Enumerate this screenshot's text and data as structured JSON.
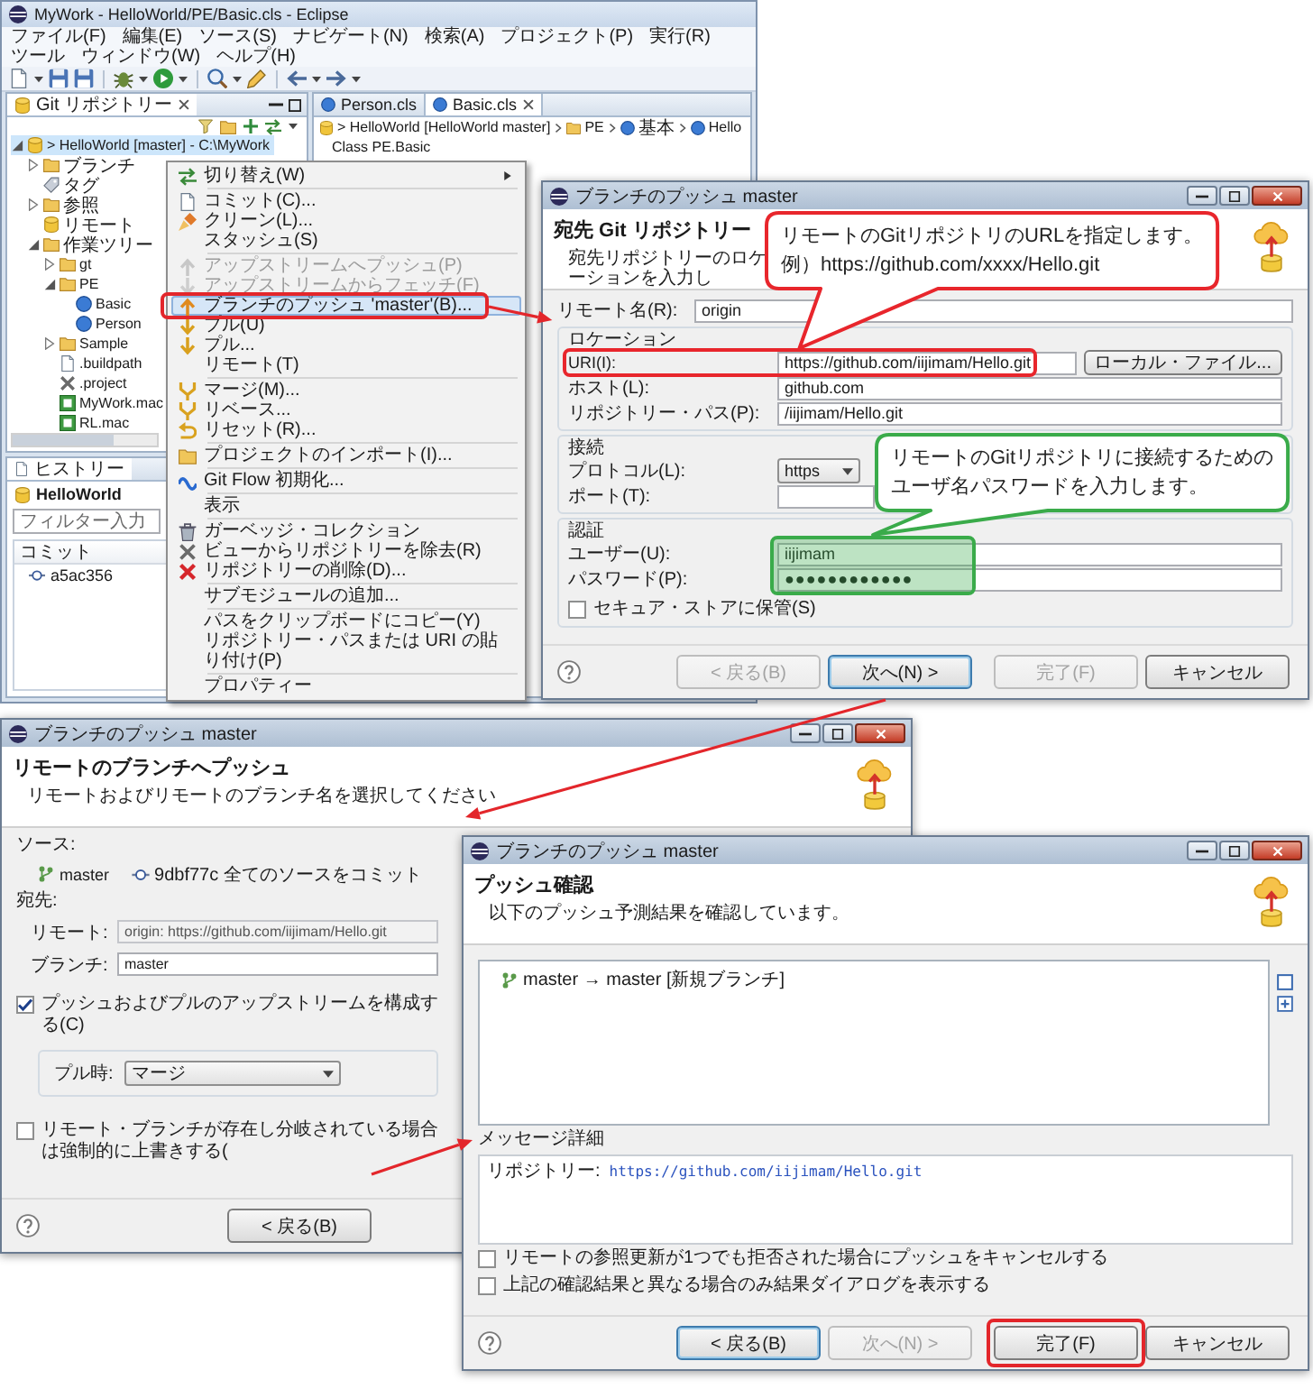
{
  "ide_window": {
    "title": "MyWork - HelloWorld/PE/Basic.cls - Eclipse",
    "menu_bar": [
      "ファイル(F)",
      "編集(E)",
      "ソース(S)",
      "ナビゲート(N)",
      "検索(A)",
      "プロジェクト(P)",
      "実行(R)",
      "ツール",
      "ウィンドウ(W)",
      "ヘルプ(H)"
    ],
    "repositories_view": {
      "tab": "Git リポジトリー",
      "tree": [
        {
          "kind": "repository",
          "label": "> HelloWorld [master] - C:\\MyWork",
          "expanded": true,
          "selected": true,
          "children": [
            {
              "kind": "folder",
              "label": "ブランチ",
              "expanded": false,
              "selected": false
            },
            {
              "kind": "tag",
              "label": "タグ",
              "selected": false
            },
            {
              "kind": "folder",
              "label": "参照",
              "expanded": false,
              "selected": false
            },
            {
              "kind": "remote",
              "label": "リモート",
              "selected": false
            },
            {
              "kind": "folder",
              "label": "作業ツリー",
              "expanded": true,
              "selected": false,
              "children": [
                {
                  "kind": "folder",
                  "label": "gt",
                  "expanded": false,
                  "selected": false
                },
                {
                  "kind": "folder",
                  "label": "PE",
                  "expanded": true,
                  "selected": false,
                  "children": [
                    {
                      "kind": "class",
                      "label": "Basic",
                      "selected": false
                    },
                    {
                      "kind": "class",
                      "label": "Person",
                      "selected": false
                    }
                  ]
                },
                {
                  "kind": "folder",
                  "label": "Sample",
                  "expanded": false,
                  "selected": false
                },
                {
                  "kind": "file",
                  "label": ".buildpath",
                  "selected": false
                },
                {
                  "kind": "project",
                  "label": ".project",
                  "selected": false
                },
                {
                  "kind": "routine",
                  "label": "MyWork.mac",
                  "selected": false
                },
                {
                  "kind": "routine",
                  "label": "RL.mac",
                  "selected": false
                }
              ]
            }
          ]
        }
      ]
    },
    "editor": {
      "tabs": [
        {
          "label": "Person.cls",
          "selected": false
        },
        {
          "label": "Basic.cls",
          "selected": true
        }
      ],
      "breadcrumb": [
        "> HelloWorld [HelloWorld master]",
        "PE",
        "基本",
        "Hello"
      ],
      "code_line": "Class PE.Basic"
    },
    "history_view": {
      "tab": "ヒストリー",
      "title": "HelloWorld",
      "filter": {
        "placeholder": "フィルター入力"
      },
      "columns": [
        "コミット"
      ],
      "rows": [
        [
          "a5ac356"
        ]
      ]
    }
  },
  "context_menu": {
    "groups": [
      [
        {
          "label": "切り替え(W)",
          "disabled": false,
          "selected": false,
          "submenu": true
        }
      ],
      [
        {
          "label": "コミット(C)...",
          "disabled": false,
          "selected": false,
          "submenu": false
        },
        {
          "label": "クリーン(L)...",
          "disabled": false,
          "selected": false,
          "submenu": false
        },
        {
          "label": "スタッシュ(S)",
          "disabled": false,
          "selected": false,
          "submenu": false
        }
      ],
      [
        {
          "label": "アップストリームへプッシュ(P)",
          "disabled": true,
          "selected": false,
          "submenu": false
        },
        {
          "label": "アップストリームからフェッチ(F)",
          "disabled": true,
          "selected": false,
          "submenu": false
        },
        {
          "label": "ブランチのプッシュ 'master'(B)...",
          "disabled": false,
          "selected": true,
          "submenu": false
        },
        {
          "label": "プル(U)",
          "disabled": false,
          "selected": false,
          "submenu": false
        },
        {
          "label": "プル...",
          "disabled": false,
          "selected": false,
          "submenu": false
        },
        {
          "label": "リモート(T)",
          "disabled": false,
          "selected": false,
          "submenu": false
        }
      ],
      [
        {
          "label": "マージ(M)...",
          "disabled": false,
          "selected": false,
          "submenu": false
        },
        {
          "label": "リベース...",
          "disabled": false,
          "selected": false,
          "submenu": false
        },
        {
          "label": "リセット(R)...",
          "disabled": false,
          "selected": false,
          "submenu": false
        }
      ],
      [
        {
          "label": "プロジェクトのインポート(I)...",
          "disabled": false,
          "selected": false,
          "submenu": false
        }
      ],
      [
        {
          "label": "Git Flow 初期化...",
          "disabled": false,
          "selected": false,
          "submenu": false
        }
      ],
      [
        {
          "label": "表示",
          "disabled": false,
          "selected": false,
          "submenu": false
        }
      ],
      [
        {
          "label": "ガーベッジ・コレクション",
          "disabled": false,
          "selected": false,
          "submenu": false
        },
        {
          "label": "ビューからリポジトリーを除去(R)",
          "disabled": false,
          "selected": false,
          "submenu": false
        },
        {
          "label": "リポジトリーの削除(D)...",
          "disabled": false,
          "selected": false,
          "submenu": false
        }
      ],
      [
        {
          "label": "サブモジュールの追加...",
          "disabled": false,
          "selected": false,
          "submenu": false
        }
      ],
      [
        {
          "label": "パスをクリップボードにコピー(Y)",
          "disabled": false,
          "selected": false,
          "submenu": false
        },
        {
          "label": "リポジトリー・パスまたは URI の貼り付け(P)",
          "disabled": false,
          "selected": false,
          "submenu": false
        }
      ],
      [
        {
          "label": "プロパティー",
          "disabled": false,
          "selected": false,
          "submenu": false
        }
      ]
    ]
  },
  "dialogs": [
    {
      "kind": "destination",
      "title": "ブランチのプッシュ master",
      "page_title": "宛先 Git リポジトリー",
      "page_description": "宛先リポジトリーのロケーションを入力し",
      "remote_name": {
        "label": "リモート名(R):",
        "value": "origin"
      },
      "groups": [
        {
          "label": "ロケーション",
          "fields": [
            {
              "kind": "text",
              "label": "URI(I):",
              "value": "https://github.com/iijimam/Hello.git",
              "button": "ローカル・ファイル..."
            },
            {
              "kind": "text",
              "label": "ホスト(L):",
              "value": "github.com"
            },
            {
              "kind": "text",
              "label": "リポジトリー・パス(P):",
              "value": "/iijimam/Hello.git"
            }
          ]
        },
        {
          "label": "接続",
          "fields": [
            {
              "kind": "dropdown",
              "label": "プロトコル(L):",
              "value": "https"
            },
            {
              "kind": "text",
              "label": "ポート(T):"
            }
          ]
        },
        {
          "label": "認証",
          "fields": [
            {
              "kind": "text",
              "label": "ユーザー(U):",
              "value": "iijimam"
            },
            {
              "kind": "password",
              "label": "パスワード(P):",
              "value": "●●●●●●●●●●●●"
            }
          ],
          "checkbox": {
            "label": "セキュア・ストアに保管(S)",
            "checked": false
          }
        }
      ],
      "buttons": [
        {
          "label": "< 戻る(B)",
          "disabled": true,
          "focused": false
        },
        {
          "label": "次へ(N) >",
          "disabled": false,
          "focused": true
        },
        {
          "label": "完了(F)",
          "disabled": true,
          "focused": false
        },
        {
          "label": "キャンセル",
          "disabled": false,
          "focused": false
        }
      ]
    },
    {
      "kind": "push_branch",
      "title": "ブランチのプッシュ master",
      "page_title": "リモートのブランチへプッシュ",
      "page_description": "リモートおよびリモートのブランチ名を選択してください",
      "source_label": "ソース:",
      "source_branch": "master",
      "source_commit": "9dbf77c 全てのソースをコミット",
      "destination_label": "宛先:",
      "fields": [
        {
          "label": "リモート:",
          "value": "origin: https://github.com/iijimam/Hello.git",
          "disabled": true
        },
        {
          "label": "ブランチ:",
          "value": "master",
          "disabled": false
        }
      ],
      "upstream": {
        "label": "プッシュおよびプルのアップストリームを構成する(C)",
        "checked": true
      },
      "pull_mode": {
        "label": "プル時:",
        "value": "マージ"
      },
      "force": {
        "label": "リモート・ブランチが存在し分岐されている場合は強制的に上書きする(",
        "checked": false
      },
      "buttons": [
        {
          "label": "< 戻る(B)",
          "disabled": false,
          "focused": false
        }
      ]
    },
    {
      "kind": "confirm",
      "title": "ブランチのプッシュ master",
      "page_title": "プッシュ確認",
      "page_description": "以下のプッシュ予測結果を確認しています。",
      "updates": [
        "master → master [新規ブランチ]"
      ],
      "message_label": "メッセージ詳細",
      "message_key": "リポジトリー:",
      "message_url": "https://github.com/iijimam/Hello.git",
      "options": [
        {
          "label": "リモートの参照更新が1つでも拒否された場合にプッシュをキャンセルする",
          "checked": false
        },
        {
          "label": "上記の確認結果と異なる場合のみ結果ダイアログを表示する",
          "checked": false
        }
      ],
      "buttons": [
        {
          "label": "< 戻る(B)",
          "disabled": false,
          "focused": true
        },
        {
          "label": "次へ(N) >",
          "disabled": true,
          "focused": false
        },
        {
          "label": "完了(F)",
          "disabled": false,
          "focused": false
        },
        {
          "label": "キャンセル",
          "disabled": false,
          "focused": false
        }
      ]
    }
  ],
  "callouts": [
    {
      "lines": [
        "リモートのGitリポジトリのURLを指定します。",
        "例）https://github.com/xxxx/Hello.git"
      ],
      "color": "#e8262c"
    },
    {
      "lines": [
        "リモートのGitリポジトリに接続するための",
        "ユーザ名パスワードを入力します。"
      ],
      "color": "#3aab4a"
    }
  ]
}
